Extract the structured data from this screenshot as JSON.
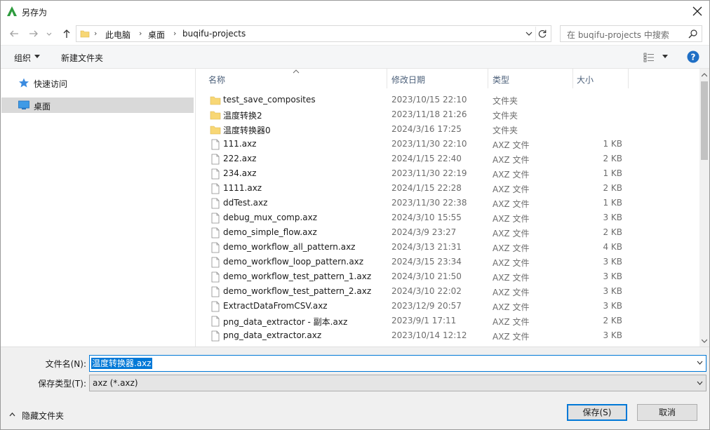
{
  "window": {
    "title": "另存为"
  },
  "address": {
    "segments": [
      "此电脑",
      "桌面",
      "buqifu-projects"
    ]
  },
  "search": {
    "placeholder": "在 buqifu-projects 中搜索"
  },
  "toolbar": {
    "organize_label": "组织",
    "new_folder_label": "新建文件夹"
  },
  "nav": {
    "items": [
      {
        "label": "快速访问",
        "icon": "star-icon"
      },
      {
        "label": "桌面",
        "icon": "desktop-icon",
        "selected": true
      }
    ]
  },
  "columns": {
    "name": "名称",
    "date": "修改日期",
    "type": "类型",
    "size": "大小"
  },
  "files": [
    {
      "name": "test_save_composites",
      "date": "2023/10/15 22:10",
      "type": "文件夹",
      "size": "",
      "kind": "folder"
    },
    {
      "name": "温度转换2",
      "date": "2023/11/18 21:26",
      "type": "文件夹",
      "size": "",
      "kind": "folder"
    },
    {
      "name": "温度转换器0",
      "date": "2024/3/16 17:25",
      "type": "文件夹",
      "size": "",
      "kind": "folder"
    },
    {
      "name": "111.axz",
      "date": "2023/11/30 22:10",
      "type": "AXZ 文件",
      "size": "1 KB",
      "kind": "file"
    },
    {
      "name": "222.axz",
      "date": "2024/1/15 22:40",
      "type": "AXZ 文件",
      "size": "2 KB",
      "kind": "file"
    },
    {
      "name": "234.axz",
      "date": "2023/11/30 22:19",
      "type": "AXZ 文件",
      "size": "1 KB",
      "kind": "file"
    },
    {
      "name": "1111.axz",
      "date": "2024/1/15 22:28",
      "type": "AXZ 文件",
      "size": "2 KB",
      "kind": "file"
    },
    {
      "name": "ddTest.axz",
      "date": "2023/11/30 22:38",
      "type": "AXZ 文件",
      "size": "1 KB",
      "kind": "file"
    },
    {
      "name": "debug_mux_comp.axz",
      "date": "2024/3/10 15:55",
      "type": "AXZ 文件",
      "size": "3 KB",
      "kind": "file"
    },
    {
      "name": "demo_simple_flow.axz",
      "date": "2024/3/9 23:27",
      "type": "AXZ 文件",
      "size": "2 KB",
      "kind": "file"
    },
    {
      "name": "demo_workflow_all_pattern.axz",
      "date": "2024/3/13 21:31",
      "type": "AXZ 文件",
      "size": "4 KB",
      "kind": "file"
    },
    {
      "name": "demo_workflow_loop_pattern.axz",
      "date": "2024/3/15 23:34",
      "type": "AXZ 文件",
      "size": "3 KB",
      "kind": "file"
    },
    {
      "name": "demo_workflow_test_pattern_1.axz",
      "date": "2024/3/10 21:50",
      "type": "AXZ 文件",
      "size": "3 KB",
      "kind": "file"
    },
    {
      "name": "demo_workflow_test_pattern_2.axz",
      "date": "2024/3/10 22:02",
      "type": "AXZ 文件",
      "size": "3 KB",
      "kind": "file"
    },
    {
      "name": "ExtractDataFromCSV.axz",
      "date": "2023/12/9 20:57",
      "type": "AXZ 文件",
      "size": "3 KB",
      "kind": "file"
    },
    {
      "name": "png_data_extractor - 副本.axz",
      "date": "2023/9/1 17:11",
      "type": "AXZ 文件",
      "size": "2 KB",
      "kind": "file"
    },
    {
      "name": "png_data_extractor.axz",
      "date": "2023/10/14 12:12",
      "type": "AXZ 文件",
      "size": "3 KB",
      "kind": "file"
    }
  ],
  "form": {
    "filename_label": "文件名(N):",
    "filename_value": "温度转换器.axz",
    "filetype_label": "保存类型(T):",
    "filetype_value": "axz (*.axz)",
    "hide_folders_label": "隐藏文件夹",
    "save_label": "保存(S)",
    "cancel_label": "取消"
  },
  "colors": {
    "accent": "#0078d7",
    "folder": "#f8d775",
    "selected_nav": "#d9d9d9",
    "app_icon": "#2e9b3e"
  }
}
